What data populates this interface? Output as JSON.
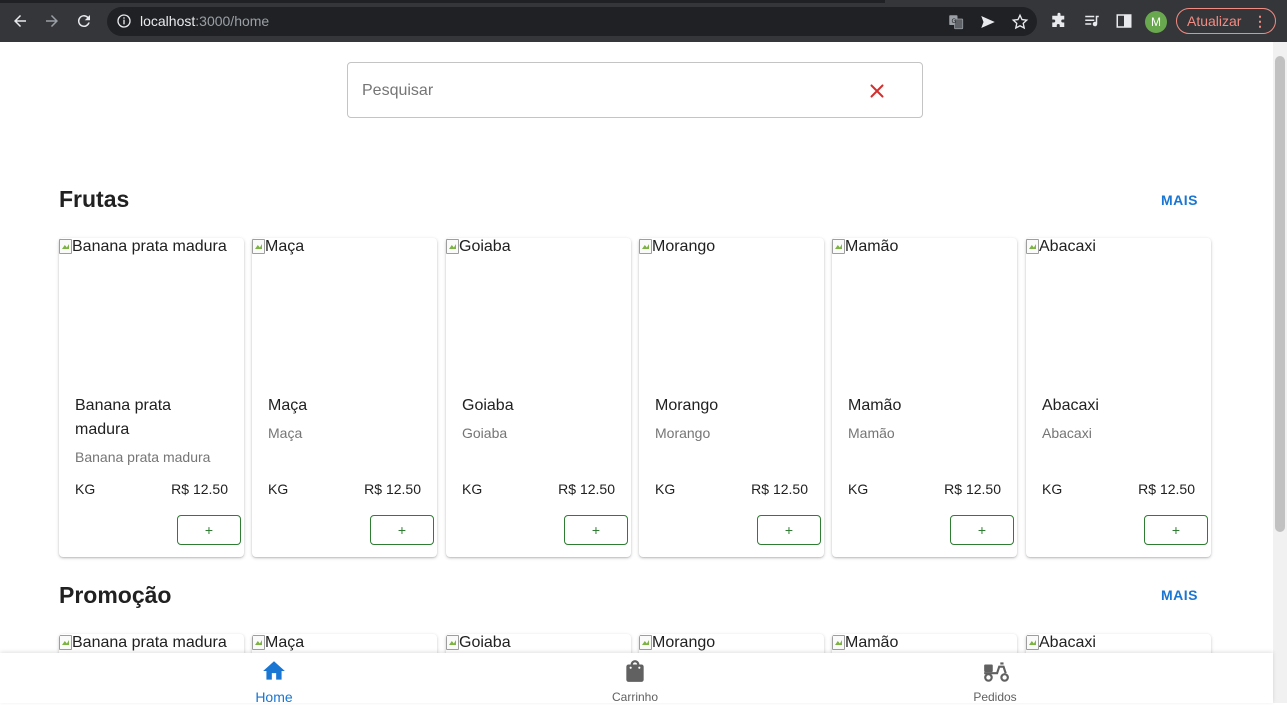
{
  "browser": {
    "url_host": "localhost",
    "url_path": ":3000/home",
    "profile_initial": "M",
    "update_label": "Atualizar"
  },
  "search": {
    "placeholder": "Pesquisar",
    "value": ""
  },
  "sections": [
    {
      "title": "Frutas",
      "more_label": "MAIS",
      "products": [
        {
          "image_alt": "Banana prata madura",
          "name": "Banana prata madura",
          "description": "Banana prata madura",
          "unit": "KG",
          "price": "R$ 12.50",
          "add_label": "+"
        },
        {
          "image_alt": "Maça",
          "name": "Maça",
          "description": "Maça",
          "unit": "KG",
          "price": "R$ 12.50",
          "add_label": "+"
        },
        {
          "image_alt": "Goiaba",
          "name": "Goiaba",
          "description": "Goiaba",
          "unit": "KG",
          "price": "R$ 12.50",
          "add_label": "+"
        },
        {
          "image_alt": "Morango",
          "name": "Morango",
          "description": "Morango",
          "unit": "KG",
          "price": "R$ 12.50",
          "add_label": "+"
        },
        {
          "image_alt": "Mamão",
          "name": "Mamão",
          "description": "Mamão",
          "unit": "KG",
          "price": "R$ 12.50",
          "add_label": "+"
        },
        {
          "image_alt": "Abacaxi",
          "name": "Abacaxi",
          "description": "Abacaxi",
          "unit": "KG",
          "price": "R$ 12.50",
          "add_label": "+"
        }
      ]
    },
    {
      "title": "Promoção",
      "more_label": "MAIS",
      "products": [
        {
          "image_alt": "Banana prata madura"
        },
        {
          "image_alt": "Maça"
        },
        {
          "image_alt": "Goiaba"
        },
        {
          "image_alt": "Morango"
        },
        {
          "image_alt": "Mamão"
        },
        {
          "image_alt": "Abacaxi"
        }
      ]
    }
  ],
  "bottom_nav": [
    {
      "label": "Home",
      "icon": "home-icon",
      "active": true
    },
    {
      "label": "Carrinho",
      "icon": "shopping-bag-icon",
      "active": false
    },
    {
      "label": "Pedidos",
      "icon": "delivery-scooter-icon",
      "active": false
    }
  ],
  "colors": {
    "accent": "#1976d2",
    "add_button": "#2e7d32",
    "clear_icon": "#d32f2f"
  }
}
